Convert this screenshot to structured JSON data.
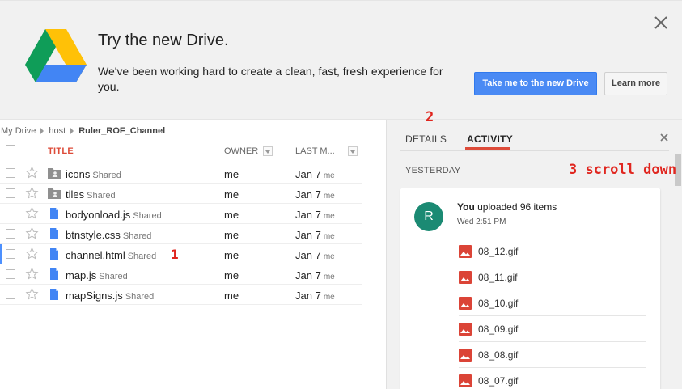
{
  "promo": {
    "title": "Try the new Drive.",
    "text": "We've been working hard to create a clean, fast, fresh experience for you.",
    "primary_button": "Take me to the new Drive",
    "secondary_button": "Learn more"
  },
  "breadcrumb": [
    "My Drive",
    "host",
    "Ruler_ROF_Channel"
  ],
  "list": {
    "columns": {
      "title": "TITLE",
      "owner": "OWNER",
      "modified": "LAST M..."
    },
    "rows": [
      {
        "name": "icons",
        "shared": "Shared",
        "owner": "me",
        "date": "Jan 7",
        "modified_by": "me",
        "type": "shared-folder"
      },
      {
        "name": "tiles",
        "shared": "Shared",
        "owner": "me",
        "date": "Jan 7",
        "modified_by": "me",
        "type": "shared-folder"
      },
      {
        "name": "bodyonload.js",
        "shared": "Shared",
        "owner": "me",
        "date": "Jan 7",
        "modified_by": "me",
        "type": "document"
      },
      {
        "name": "btnstyle.css",
        "shared": "Shared",
        "owner": "me",
        "date": "Jan 7",
        "modified_by": "me",
        "type": "document"
      },
      {
        "name": "channel.html",
        "shared": "Shared",
        "owner": "me",
        "date": "Jan 7",
        "modified_by": "me",
        "type": "document"
      },
      {
        "name": "map.js",
        "shared": "Shared",
        "owner": "me",
        "date": "Jan 7",
        "modified_by": "me",
        "type": "document"
      },
      {
        "name": "mapSigns.js",
        "shared": "Shared",
        "owner": "me",
        "date": "Jan 7",
        "modified_by": "me",
        "type": "document"
      }
    ]
  },
  "pane": {
    "tabs": [
      "DETAILS",
      "ACTIVITY"
    ],
    "active_tab": "ACTIVITY",
    "section": "YESTERDAY",
    "activity": {
      "avatar_letter": "R",
      "actor": "You",
      "action": "uploaded 96 items",
      "time": "Wed 2:51 PM",
      "files": [
        "08_12.gif",
        "08_11.gif",
        "08_10.gif",
        "08_09.gif",
        "08_08.gif",
        "08_07.gif"
      ]
    }
  },
  "annotations": {
    "one": "1",
    "two": "2",
    "three": "3 scroll down"
  },
  "colors": {
    "accent_red": "#dd4b39",
    "primary_blue": "#4a8af4",
    "avatar_green": "#1b8a73",
    "doc_icon_blue": "#4285f4",
    "image_icon_red": "#db4437",
    "annotation_red": "#e0261f"
  }
}
